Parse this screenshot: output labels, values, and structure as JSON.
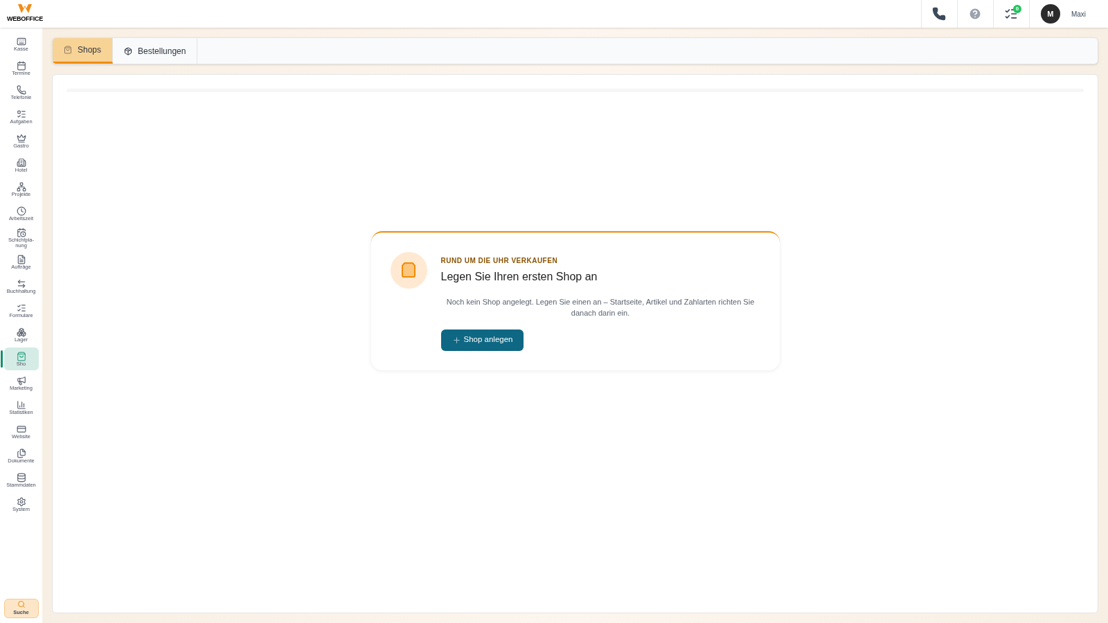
{
  "brand": {
    "name": "WEBOFFICE"
  },
  "header": {
    "task_count": "0",
    "avatar_initial": "M",
    "user_name": "Maxi"
  },
  "sidebar": {
    "items": [
      {
        "label": "Kasse",
        "selected": false
      },
      {
        "label": "Termine",
        "selected": false
      },
      {
        "label": "Telefonie",
        "selected": false
      },
      {
        "label": "Aufgaben",
        "selected": false
      },
      {
        "label": "Gastro",
        "selected": false
      },
      {
        "label": "Hotel",
        "selected": false
      },
      {
        "label": "Projekte",
        "selected": false
      },
      {
        "label": "Arbeitszeit",
        "selected": false
      },
      {
        "label": "Schichtpla-nung",
        "selected": false
      },
      {
        "label": "Aufträge",
        "selected": false
      },
      {
        "label": "Buchhaltung",
        "selected": false
      },
      {
        "label": "Formulare",
        "selected": false
      },
      {
        "label": "Lager",
        "selected": false
      },
      {
        "label": "Sho",
        "selected": true
      },
      {
        "label": "Marketing",
        "selected": false
      },
      {
        "label": "Statistiken",
        "selected": false
      },
      {
        "label": "Website",
        "selected": false
      },
      {
        "label": "Dokumente",
        "selected": false
      },
      {
        "label": "Stammdaten",
        "selected": false
      },
      {
        "label": "System",
        "selected": false
      }
    ],
    "search": {
      "label": "Suche"
    }
  },
  "tabs": [
    {
      "label": "Shops",
      "selected": true
    },
    {
      "label": "Bestellungen",
      "selected": false
    }
  ],
  "empty_state": {
    "eyebrow": "RUND UM DIE UHR VERKAUFEN",
    "title": "Legen Sie Ihren ersten Shop an",
    "description": "Noch kein Shop angelegt. Legen Sie einen an – Startseite, Artikel und Zahlarten richten Sie danach darin ein.",
    "button": "Shop anlegen"
  }
}
